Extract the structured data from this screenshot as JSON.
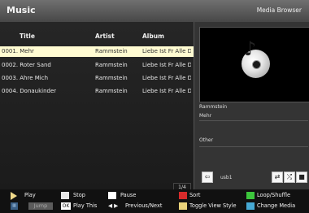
{
  "title_bar": {
    "app_title": "Music",
    "mode_label": "Media Browser"
  },
  "list": {
    "columns": [
      "Title",
      "Artist",
      "Album"
    ],
    "rows": [
      {
        "title": "0001. Mehr",
        "artist": "Rammstein",
        "album": "Liebe Ist Fr Alle D...",
        "selected": true
      },
      {
        "title": "0002. Roter Sand",
        "artist": "Rammstein",
        "album": "Liebe Ist Fr Alle D...",
        "selected": false
      },
      {
        "title": "0003. Ahre Mich",
        "artist": "Rammstein",
        "album": "Liebe Ist Fr Alle D...",
        "selected": false
      },
      {
        "title": "0004. Donaukinder",
        "artist": "Rammstein",
        "album": "Liebe Ist Fr Alle D...",
        "selected": false
      }
    ],
    "page_indicator": "1/4"
  },
  "preview": {
    "artist": "Rammstein",
    "track": "Mehr",
    "other_label": "Other",
    "source": "usb1",
    "icons": [
      "back-icon",
      "repeat-icon",
      "shuffle-icon",
      "stop-square-icon"
    ]
  },
  "legend": {
    "play": "Play",
    "stop": "Stop",
    "pause": "Pause",
    "sort": "Sort",
    "loop_shuffle": "Loop/Shuffle",
    "jump_key": "Jump",
    "ok_key": "OK",
    "play_this": "Play This",
    "prev_next": "Previous/Next",
    "toggle_view": "Toggle View Style",
    "change_media": "Change Media"
  },
  "colors": {
    "selection": "#fffbd2",
    "red_key": "#d72b2b",
    "green_key": "#3cc63c",
    "yellow_key": "#e9d27a",
    "blue_key": "#46a9d4"
  }
}
